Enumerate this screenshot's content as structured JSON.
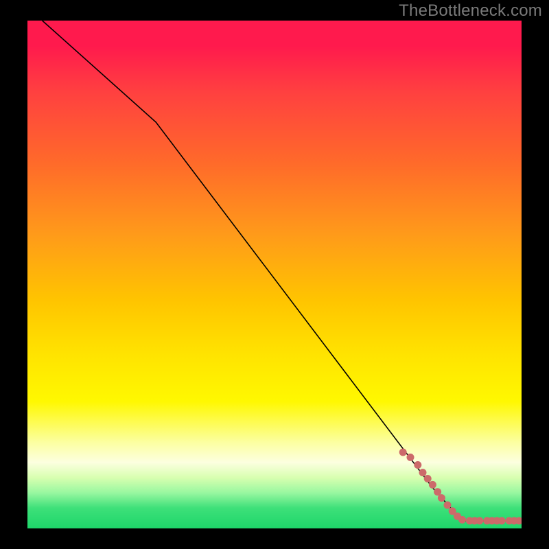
{
  "watermark": "TheBottleneck.com",
  "chart_data": {
    "type": "line",
    "title": "",
    "xlabel": "",
    "ylabel": "",
    "xlim": [
      0,
      100
    ],
    "ylim": [
      0,
      100
    ],
    "grid": false,
    "series": [
      {
        "name": "curve",
        "style": "line",
        "color": "#000000",
        "x": [
          3,
          26,
          82,
          88,
          100
        ],
        "y": [
          100,
          80,
          8,
          1.5,
          1.5
        ]
      },
      {
        "name": "markers",
        "style": "scatter",
        "color": "#cc6a6a",
        "x": [
          76,
          77.5,
          79,
          80,
          81,
          82,
          83,
          83.8,
          85,
          86,
          87,
          88,
          89.5,
          90.5,
          91.5,
          93,
          94,
          95,
          96,
          97.5,
          98.5,
          99.5
        ],
        "y": [
          15,
          14,
          12.5,
          11,
          9.8,
          8.6,
          7.2,
          6,
          4.6,
          3.4,
          2.4,
          1.7,
          1.5,
          1.5,
          1.5,
          1.5,
          1.5,
          1.5,
          1.5,
          1.5,
          1.5,
          1.5
        ]
      }
    ],
    "gradient_bands": [
      {
        "stop": 0,
        "color": "#ff1a4d"
      },
      {
        "stop": 5,
        "color": "#ff1a4d"
      },
      {
        "stop": 14,
        "color": "#ff4040"
      },
      {
        "stop": 28,
        "color": "#ff6a2a"
      },
      {
        "stop": 42,
        "color": "#ff9a1a"
      },
      {
        "stop": 55,
        "color": "#ffc400"
      },
      {
        "stop": 66,
        "color": "#ffe400"
      },
      {
        "stop": 75,
        "color": "#fff800"
      },
      {
        "stop": 83,
        "color": "#fcffa0"
      },
      {
        "stop": 87,
        "color": "#fcffe0"
      },
      {
        "stop": 90,
        "color": "#d8ffb0"
      },
      {
        "stop": 93,
        "color": "#98f7a0"
      },
      {
        "stop": 96,
        "color": "#3de079"
      },
      {
        "stop": 100,
        "color": "#1ed66a"
      }
    ]
  }
}
